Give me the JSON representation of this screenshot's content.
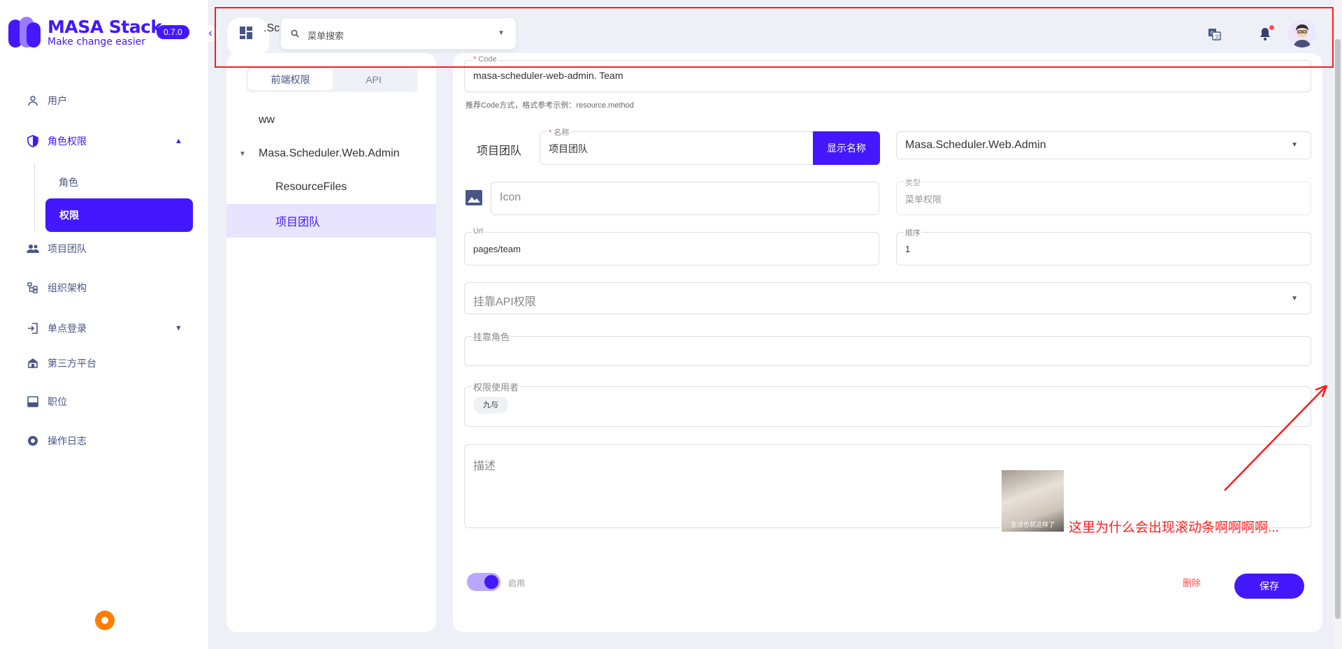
{
  "brand": {
    "title": "MASA Stack",
    "subtitle": "Make change easier",
    "version": "0.7.0"
  },
  "nav": {
    "users": "用户",
    "roles_perm": "角色权限",
    "role": "角色",
    "permission": "权限",
    "team": "项目团队",
    "org": "组织架构",
    "sso": "单点登录",
    "third_party": "第三方平台",
    "position": "职位",
    "oplog": "操作日志"
  },
  "header": {
    "crumb": ".Sch",
    "search_placeholder": "菜单搜索"
  },
  "tabs": {
    "frontend": "前端权限",
    "api": "API"
  },
  "tree": {
    "ww": "ww",
    "app": "Masa.Scheduler.Web.Admin",
    "resource": "ResourceFiles",
    "team": "项目团队"
  },
  "form": {
    "code_label": "Code",
    "code_value": "masa-scheduler-web-admin. Team",
    "code_hint": "推荐Code方式，格式参考示例：resource.method",
    "name_prefix": "项目团队",
    "name_label": "名称",
    "name_value": "项目团队",
    "name_button": "显示名称",
    "app_select": "Masa.Scheduler.Web.Admin",
    "icon_placeholder": "Icon",
    "type_label": "类型",
    "type_value": "菜单权限",
    "url_label": "Url",
    "url_value": "pages/team",
    "order_label": "顺序",
    "order_value": "1",
    "api_perm_placeholder": "挂靠API权限",
    "role_label": "挂靠角色",
    "users_label": "权限使用者",
    "user_chip": "九与",
    "desc_placeholder": "描述",
    "enable_label": "启用",
    "delete": "删除",
    "save": "保存"
  },
  "annotation": {
    "text": "这里为什么会出现滚动条啊啊啊啊...",
    "meme_caption": "生活也就这样了"
  },
  "colors": {
    "accent": "#4318ff",
    "annotation": "#ff1a1a",
    "danger": "#ff4d4f"
  }
}
